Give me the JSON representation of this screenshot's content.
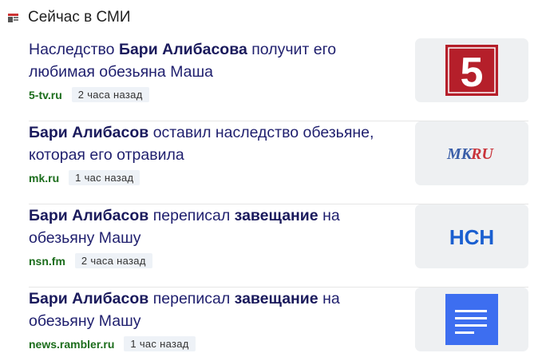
{
  "header": {
    "title": "Сейчас в СМИ",
    "icon": "news-icon"
  },
  "items": [
    {
      "title_parts": [
        {
          "text": "Наследство ",
          "bold": false
        },
        {
          "text": "Бари Алибасова",
          "bold": true
        },
        {
          "text": " получит его любимая обезьяна Маша",
          "bold": false
        }
      ],
      "source": "5-tv.ru",
      "time": "2 часа назад",
      "logo": {
        "name": "channel-5-logo",
        "glyph": "5",
        "color": "#b51f2a"
      }
    },
    {
      "title_parts": [
        {
          "text": "Бари Алибасов",
          "bold": true
        },
        {
          "text": " оставил наследство обезьяне, которая его отравила",
          "bold": false
        }
      ],
      "source": "mk.ru",
      "time": "1 час назад",
      "logo": {
        "name": "mk-logo",
        "glyph": "MKRU",
        "color": "#3a5ea8"
      }
    },
    {
      "title_parts": [
        {
          "text": "Бари Алибасов",
          "bold": true
        },
        {
          "text": " переписал ",
          "bold": false
        },
        {
          "text": "завещание",
          "bold": true
        },
        {
          "text": " на обезьяну Машу",
          "bold": false
        }
      ],
      "source": "nsn.fm",
      "time": "2 часа назад",
      "logo": {
        "name": "nsn-logo",
        "glyph": "НСН",
        "color": "#1a5fd0"
      }
    },
    {
      "title_parts": [
        {
          "text": "Бари Алибасов",
          "bold": true
        },
        {
          "text": " переписал ",
          "bold": false
        },
        {
          "text": "завещание",
          "bold": true
        },
        {
          "text": " на обезьяну Машу",
          "bold": false
        }
      ],
      "source": "news.rambler.ru",
      "time": "1 час назад",
      "logo": {
        "name": "document-icon",
        "glyph": "",
        "color": "#3d6ef0"
      }
    }
  ]
}
